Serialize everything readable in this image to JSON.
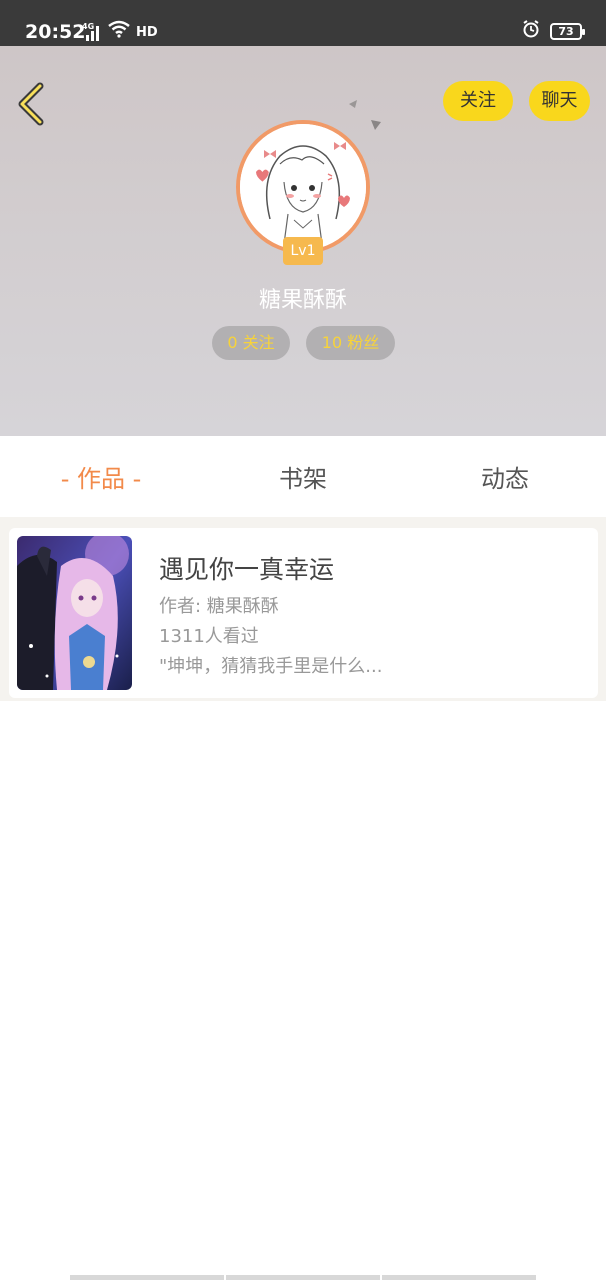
{
  "status_bar": {
    "time": "20:52",
    "network": "4G",
    "hd": "HD",
    "battery": "73"
  },
  "header": {
    "follow_label": "关注",
    "chat_label": "聊天",
    "level": "Lv1",
    "username": "糖果酥酥",
    "following": "0 关注",
    "fans": "10 粉丝"
  },
  "tabs": [
    {
      "label": "- 作品 -",
      "active": true
    },
    {
      "label": "书架",
      "active": false
    },
    {
      "label": "动态",
      "active": false
    }
  ],
  "works": [
    {
      "title": "遇见你一真幸运",
      "author": "作者: 糖果酥酥",
      "views": "1311人看过",
      "snippet": "\"坤坤，猜猜我手里是什么..."
    }
  ],
  "colors": {
    "accent": "#f28a4a",
    "button_yellow": "#f9d71c",
    "stat_text": "#f7d33a"
  }
}
